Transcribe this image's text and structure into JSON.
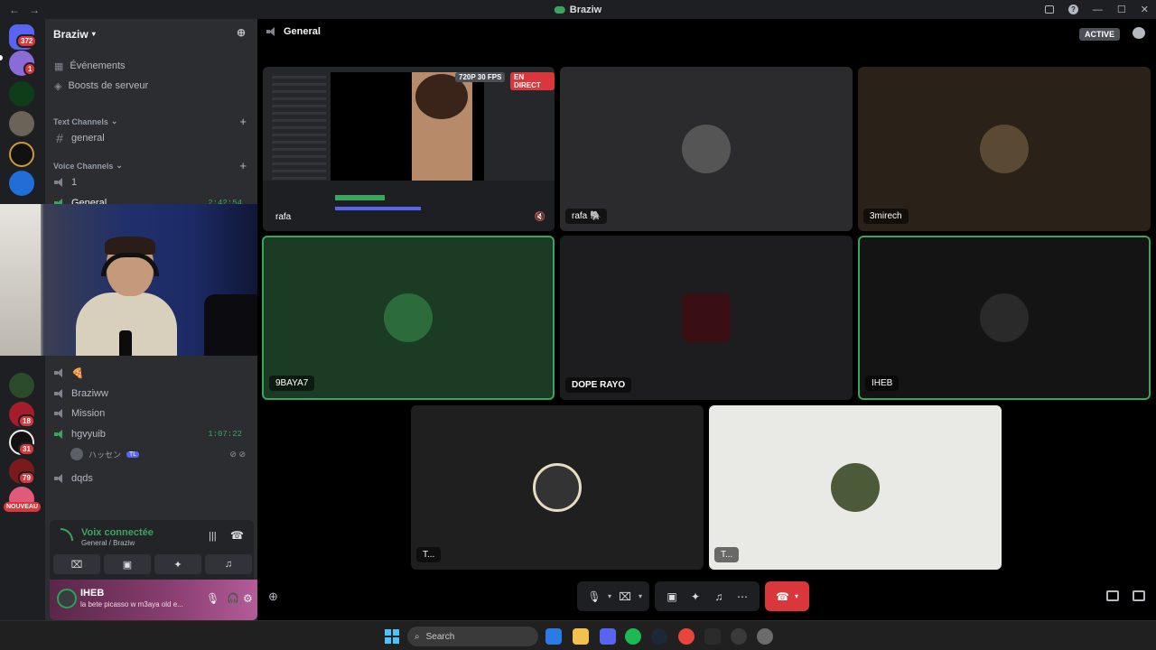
{
  "window": {
    "title": "Braziw"
  },
  "rail": {
    "badges": [
      "372",
      "1",
      "18",
      "31",
      "79"
    ],
    "new_label": "NOUVEAU"
  },
  "sidebar": {
    "guild_name": "Braziw",
    "top_items": [
      "Événements",
      "Boosts de serveur"
    ],
    "text_category": "Text Channels",
    "text_channels": [
      "general"
    ],
    "voice_category": "Voice Channels",
    "voice_channels": [
      {
        "name": "1"
      },
      {
        "name": "General",
        "time": "2:42:54"
      },
      {
        "name": "🍕"
      },
      {
        "name": "Braziww"
      },
      {
        "name": "Mission"
      },
      {
        "name": "hgvyuib",
        "time": "1:07:22"
      },
      {
        "name": "dqds"
      }
    ],
    "sub_user": {
      "name": "ハッセン",
      "tag": "TL"
    }
  },
  "voice_panel": {
    "status": "Voix connectée",
    "location": "General / Braziw"
  },
  "user_panel": {
    "name": "IHEB",
    "status": "la bete picasso w m3aya old e..."
  },
  "main": {
    "channel": "General",
    "active_label": "ACTIVE",
    "stream": {
      "quality": "720P 30 FPS",
      "live": "EN DIRECT",
      "name": "rafa"
    },
    "tiles": [
      {
        "name": "rafa 🐘",
        "color": "#2b2b2d"
      },
      {
        "name": "3mirech",
        "color": "#2a2118"
      },
      {
        "name": "9BAYA7",
        "color": "#1c3b24"
      },
      {
        "name": "DOPE RAYO",
        "color": "#1d1d1f"
      },
      {
        "name": "IHEB",
        "color": "#141414"
      },
      {
        "name": "T...",
        "color": "#1f1f20"
      },
      {
        "name": "T...",
        "color": "#e9eae6"
      }
    ]
  },
  "taskbar": {
    "search_placeholder": "Search"
  }
}
